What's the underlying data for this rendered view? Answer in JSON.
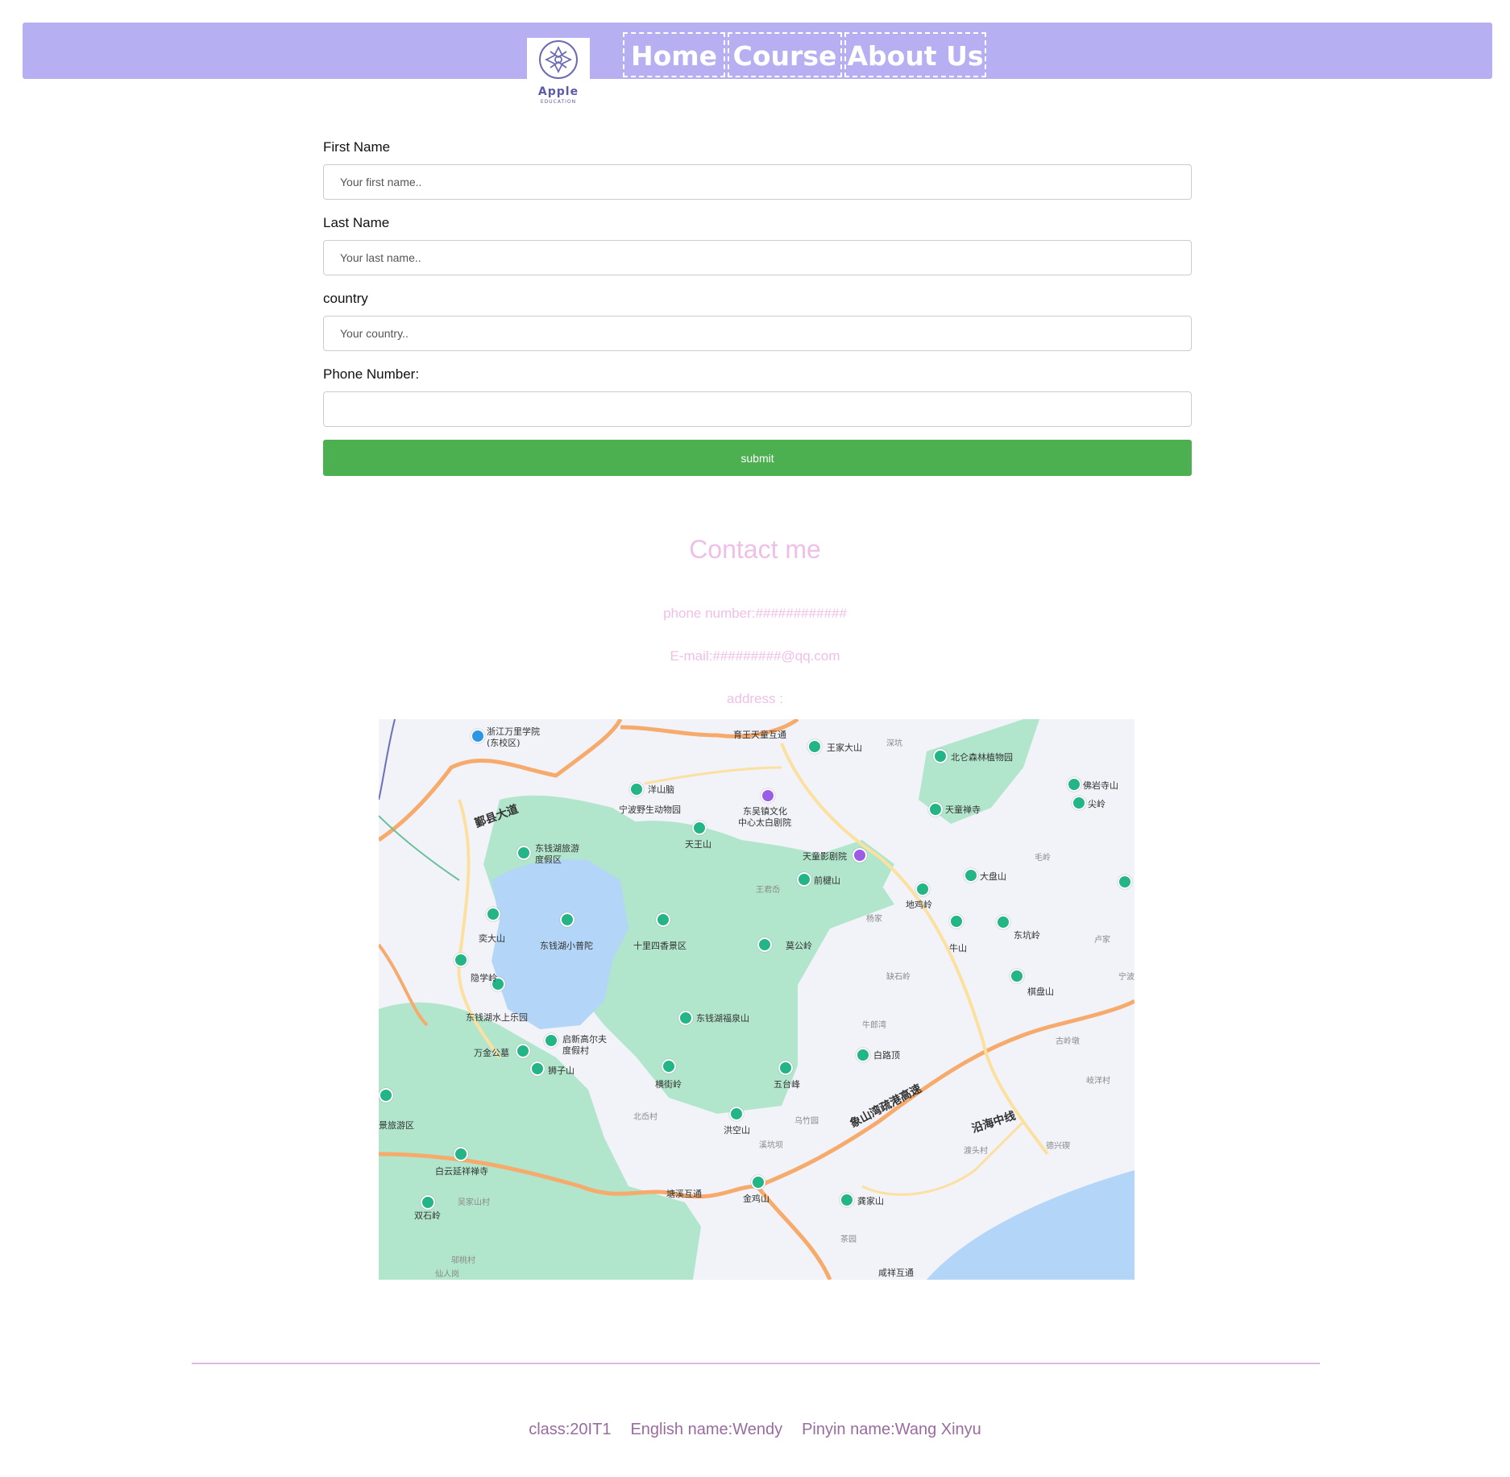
{
  "header": {
    "logo_main": "Apple",
    "logo_sub": "EDUCATION",
    "nav": [
      {
        "label": "Home"
      },
      {
        "label": "Course"
      },
      {
        "label": "About Us"
      }
    ]
  },
  "form": {
    "first_name": {
      "label": "First Name",
      "placeholder": "Your first name.."
    },
    "last_name": {
      "label": "Last Name",
      "placeholder": "Your last name.."
    },
    "country": {
      "label": "country",
      "placeholder": "Your country.."
    },
    "phone": {
      "label": "Phone Number:",
      "placeholder": ""
    },
    "submit_label": "submit"
  },
  "contact": {
    "title": "Contact me",
    "phone": "phone number:############",
    "email": "E-mail:#########@qq.com",
    "address": "address :"
  },
  "map": {
    "labels": {
      "l1": "浙江万里学院",
      "l1b": "(东校区)",
      "l2": "育王天童互通",
      "l3": "王家大山",
      "l4": "北仑森林植物园",
      "l5": "佛岩寺山",
      "l6": "尖岭",
      "l7": "洋山脑",
      "l8": "宁波野生动物园",
      "l9": "东吴镇文化",
      "l9b": "中心太白剧院",
      "l10": "天童禅寺",
      "l11": "鄞县大道",
      "l12": "天王山",
      "l13": "东钱湖旅游",
      "l13b": "度假区",
      "l14": "天童影剧院",
      "l15": "前楗山",
      "l16": "大盘山",
      "l17": "地鸡岭",
      "l18": "奕大山",
      "l19": "东钱湖小普陀",
      "l20": "十里四香景区",
      "l21": "莫公岭",
      "l22": "牛山",
      "l23": "东坑岭",
      "l24": "隐学岭",
      "l25": "棋盘山",
      "l26": "东钱湖水上乐园",
      "l27": "东钱湖福泉山",
      "l28": "启新高尔夫",
      "l28b": "度假村",
      "l29": "万金公墓",
      "l30": "白路顶",
      "l31": "狮子山",
      "l32": "横街岭",
      "l33": "五台峰",
      "l34": "景旅游区",
      "l35": "洪空山",
      "l36": "象山湾疏港高速",
      "l37": "沿海中线",
      "l38": "白云延祥禅寺",
      "l39": "塘溪互通",
      "l40": "金鸡山",
      "l41": "龚家山",
      "l42": "双石岭",
      "l43": "咸祥互通",
      "g1": "深坑",
      "g2": "毛岭",
      "g3": "王君岙",
      "g4": "杨家",
      "g5": "卢家",
      "g6": "缺石岭",
      "g7": "宁波",
      "g8": "牛郎湾",
      "g9": "古岭墩",
      "g10": "岐洋村",
      "g11": "北岙村",
      "g12": "乌竹园",
      "g13": "溪坑坝",
      "g14": "渡头村",
      "g15": "德兴碶",
      "g16": "吴家山村",
      "g17": "邬桃村",
      "g18": "仙人岗",
      "g19": "茶园"
    }
  },
  "footer": {
    "class": "class:20IT1",
    "english_name": "English name:Wendy",
    "pinyin_name": "Pinyin name:Wang Xinyu"
  }
}
